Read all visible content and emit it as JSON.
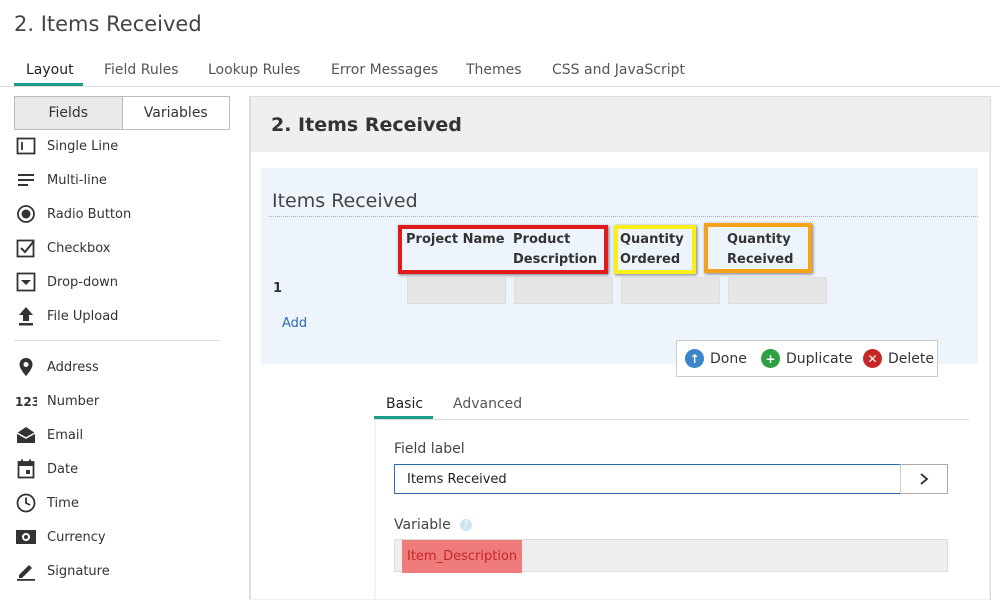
{
  "page": {
    "title": "2. Items Received"
  },
  "tabs": [
    "Layout",
    "Field Rules",
    "Lookup Rules",
    "Error Messages",
    "Themes",
    "CSS and JavaScript"
  ],
  "sidebar": {
    "toggle": [
      "Fields",
      "Variables"
    ],
    "items": [
      {
        "label": "Single Line",
        "icon": "single-line-icon"
      },
      {
        "label": "Multi-line",
        "icon": "multi-line-icon"
      },
      {
        "label": "Radio Button",
        "icon": "radio-icon"
      },
      {
        "label": "Checkbox",
        "icon": "checkbox-icon"
      },
      {
        "label": "Drop-down",
        "icon": "dropdown-icon"
      },
      {
        "label": "File Upload",
        "icon": "upload-icon"
      },
      {
        "label": "Address",
        "icon": "location-pin-icon"
      },
      {
        "label": "Number",
        "icon": "number-icon"
      },
      {
        "label": "Email",
        "icon": "envelope-icon"
      },
      {
        "label": "Date",
        "icon": "calendar-icon"
      },
      {
        "label": "Time",
        "icon": "clock-icon"
      },
      {
        "label": "Currency",
        "icon": "currency-icon"
      },
      {
        "label": "Signature",
        "icon": "pen-icon"
      }
    ]
  },
  "panel": {
    "title": "2. Items Received",
    "grid": {
      "title": "Items Received",
      "columns": [
        "Project Name",
        "Product Description",
        "Quantity Ordered",
        "Quantity Received"
      ],
      "row_number": "1",
      "add_label": "Add"
    },
    "actions": {
      "done": "Done",
      "duplicate": "Duplicate",
      "delete": "Delete"
    },
    "inner_tabs": [
      "Basic",
      "Advanced"
    ],
    "field_label": {
      "label": "Field label",
      "value": "Items Received"
    },
    "variable": {
      "label": "Variable",
      "value": "Item_Description",
      "help": "?"
    }
  },
  "colors": {
    "accent": "#1a9c8c",
    "highlight_red": "#e01b1b",
    "highlight_yellow": "#f7ef1a",
    "highlight_orange": "#f5a21c"
  }
}
